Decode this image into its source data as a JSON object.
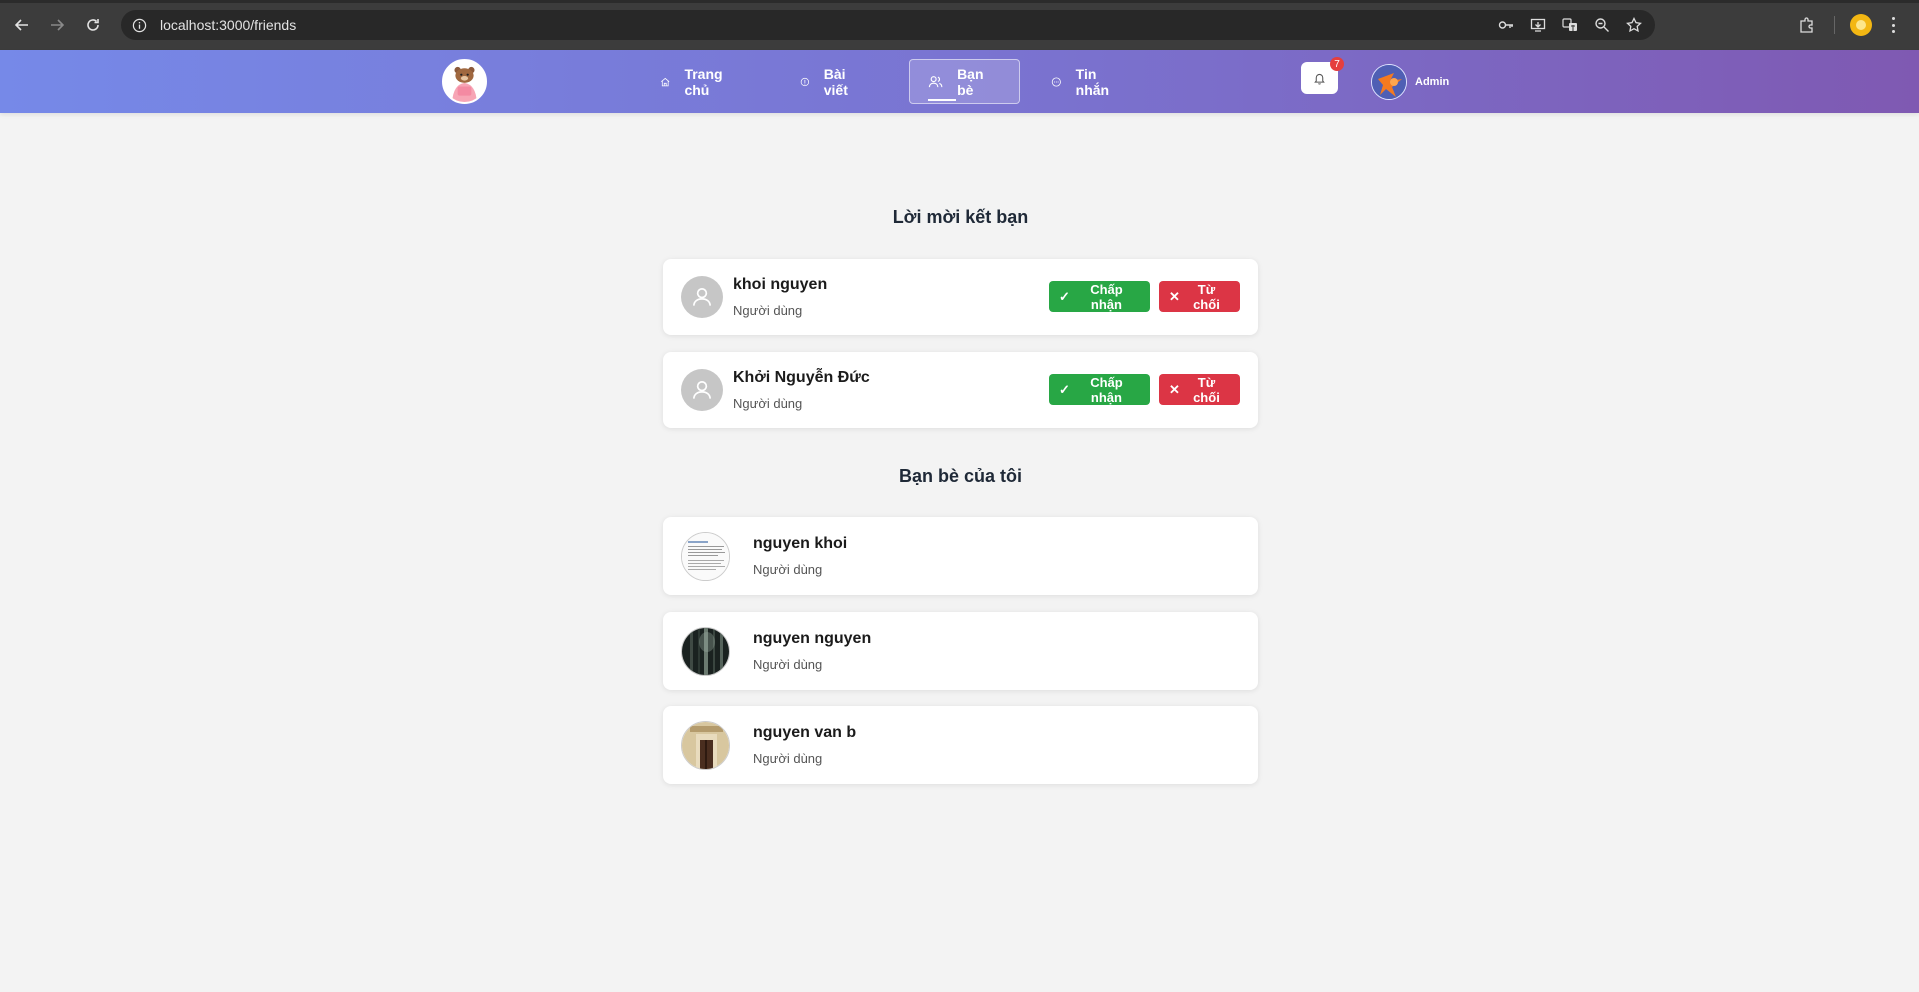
{
  "browser": {
    "url": "localhost:3000/friends"
  },
  "header": {
    "nav": [
      {
        "label": "Trang chủ",
        "icon": "home-icon"
      },
      {
        "label": "Bài viết",
        "icon": "info-icon"
      },
      {
        "label": "Bạn bè",
        "icon": "friends-icon"
      },
      {
        "label": "Tin nhắn",
        "icon": "chat-icon"
      }
    ],
    "active_nav": "Bạn bè",
    "notification_count": "7",
    "user_name": "Admin"
  },
  "requests": {
    "title": "Lời mời kết bạn",
    "accept_label": "Chấp nhận",
    "reject_label": "Từ chối",
    "items": [
      {
        "name": "khoi nguyen",
        "role": "Người dùng"
      },
      {
        "name": "Khởi Nguyễn Đức",
        "role": "Người dùng"
      }
    ]
  },
  "friends": {
    "title": "Bạn bè của tôi",
    "items": [
      {
        "name": "nguyen khoi",
        "role": "Người dùng"
      },
      {
        "name": "nguyen nguyen",
        "role": "Người dùng"
      },
      {
        "name": "nguyen van b",
        "role": "Người dùng"
      }
    ]
  },
  "colors": {
    "accept": "#28a745",
    "reject": "#dc3545",
    "header_start": "#7689e8",
    "header_end": "#7f59b2",
    "badge": "#e53e3e"
  }
}
